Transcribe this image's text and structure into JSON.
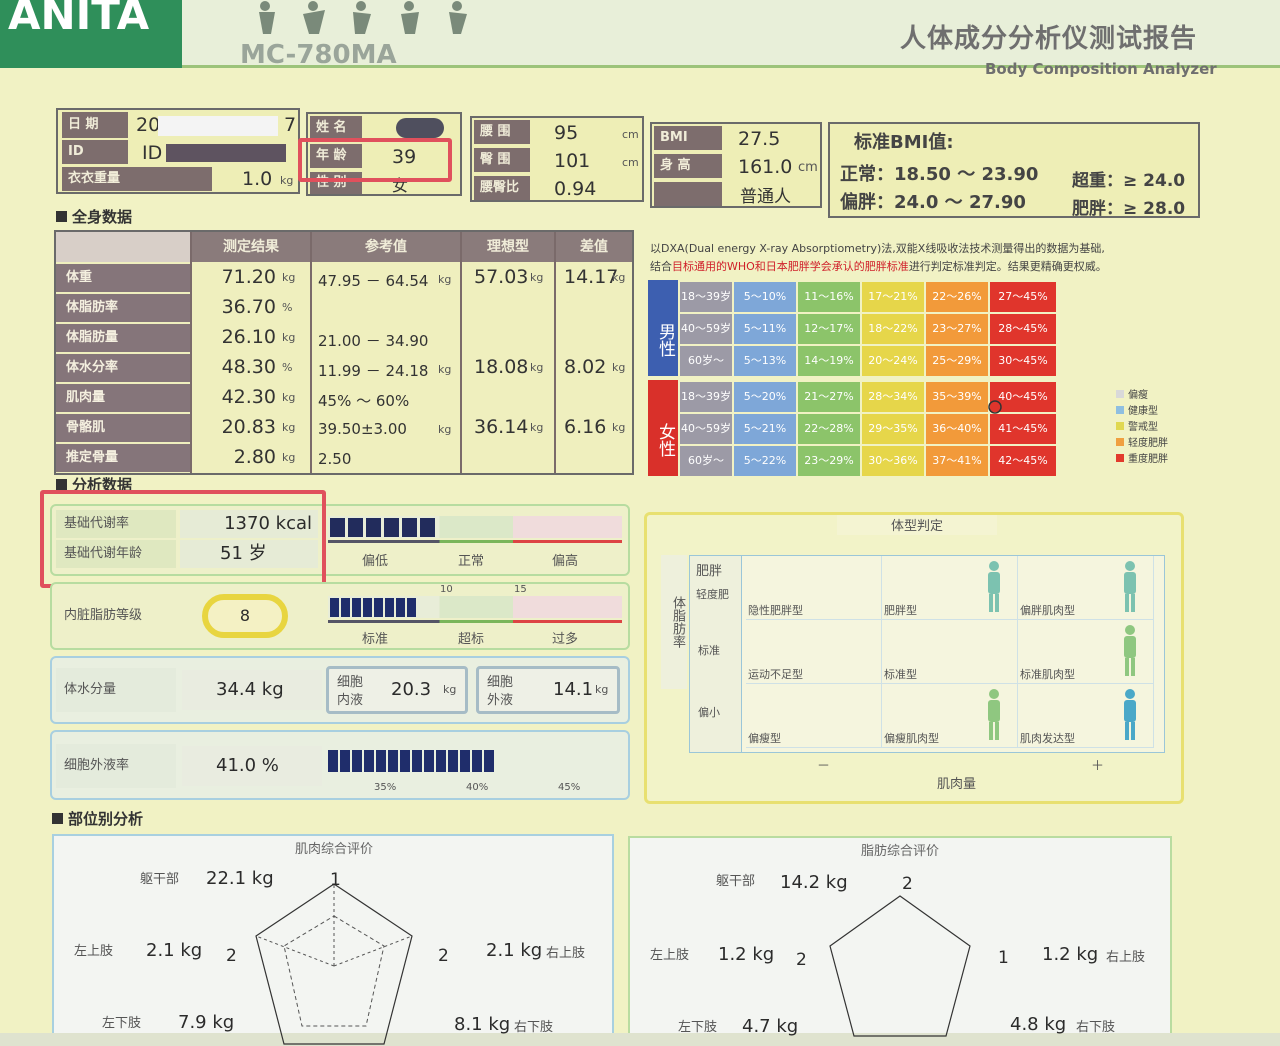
{
  "header": {
    "logo": "ANITA",
    "model": "MC-780MA",
    "title_cn": "人体成分分析仪测试报告",
    "title_en": "Body Composition Analyzer"
  },
  "info": {
    "date_label": "日 期",
    "date_value": "20",
    "date_tail": "7",
    "id_label": "ID",
    "id_value": "ID",
    "clothes_label": "衣衣重量",
    "clothes_value": "1.0",
    "clothes_unit": "kg",
    "name_label": "姓 名",
    "age_label": "年 龄",
    "age_value": "39",
    "sex_label": "性 别",
    "sex_value": "女",
    "waist_label": "腰 围",
    "waist_value": "95",
    "waist_unit": "cm",
    "hip_label": "臀 围",
    "hip_value": "101",
    "hip_unit": "cm",
    "whr_label": "腰臀比",
    "whr_value": "0.94",
    "bmi_label": "BMI",
    "bmi_value": "27.5",
    "height_label": "身 高",
    "height_value": "161.0",
    "height_unit": "cm",
    "type_value": "普通人",
    "bmi_std_title": "标准BMI值:",
    "bmi_normal": "正常：18.50 ～ 23.90",
    "bmi_over": "超重：≥ 24.0",
    "bmi_fatish": "偏胖：24.0 ～ 27.90",
    "bmi_obese": "肥胖：≥ 28.0"
  },
  "whole": {
    "section": "全身数据",
    "headers": [
      "测定结果",
      "参考值",
      "理想型",
      "差值"
    ],
    "rows": [
      {
        "label": "体重",
        "result": "71.20",
        "unit": "kg",
        "ref": "47.95 － 64.54",
        "ref_unit": "kg",
        "ideal": "57.03",
        "ideal_unit": "kg",
        "diff": "14.17",
        "diff_unit": "kg"
      },
      {
        "label": "体脂肪率",
        "result": "36.70",
        "unit": "%",
        "ref": "",
        "ref_unit": "",
        "ideal": "",
        "ideal_unit": "",
        "diff": "",
        "diff_unit": ""
      },
      {
        "label": "体脂肪量",
        "result": "26.10",
        "unit": "kg",
        "ref": "21.00 － 34.90",
        "ref_unit": "",
        "ideal": "",
        "ideal_unit": "",
        "diff": "",
        "diff_unit": ""
      },
      {
        "label": "体水分率",
        "result": "48.30",
        "unit": "%",
        "ref": "11.99 － 24.18",
        "ref_unit": "kg",
        "ideal": "18.08",
        "ideal_unit": "kg",
        "diff": "8.02",
        "diff_unit": "kg"
      },
      {
        "label": "肌肉量",
        "result": "42.30",
        "unit": "kg",
        "ref": "45% ～ 60%",
        "ref_unit": "",
        "ideal": "",
        "ideal_unit": "",
        "diff": "",
        "diff_unit": ""
      },
      {
        "label": "骨骼肌",
        "result": "20.83",
        "unit": "kg",
        "ref": "39.50±3.00",
        "ref_unit": "kg",
        "ideal": "36.14",
        "ideal_unit": "kg",
        "diff": "6.16",
        "diff_unit": "kg"
      },
      {
        "label": "推定骨量",
        "result": "2.80",
        "unit": "kg",
        "ref": "2.50",
        "ref_unit": "",
        "ideal": "",
        "ideal_unit": "",
        "diff": "",
        "diff_unit": ""
      }
    ]
  },
  "fatchart": {
    "note1": "以DXA(Dual energy X-ray Absorptiometry)法,双能X线吸收法技术测量得出的数据为基础,",
    "note2_a": "结合",
    "note2_red": "目标通用的WHO和日本肥胖学会承认的肥胖标准",
    "note2_b": "进行判定标准判定。结果更精确更权威。",
    "male": "男性",
    "female": "女性",
    "male_rows": [
      [
        "18～39岁",
        "5～10%",
        "11～16%",
        "17～21%",
        "22～26%",
        "27～45%"
      ],
      [
        "40～59岁",
        "5～11%",
        "12～17%",
        "18～22%",
        "23～27%",
        "28～45%"
      ],
      [
        "60岁～",
        "5～13%",
        "14～19%",
        "20～24%",
        "25～29%",
        "30～45%"
      ]
    ],
    "female_rows": [
      [
        "18～39岁",
        "5～20%",
        "21～27%",
        "28～34%",
        "35～39%",
        "40～45%"
      ],
      [
        "40～59岁",
        "5～21%",
        "22～28%",
        "29～35%",
        "36～40%",
        "41～45%"
      ],
      [
        "60岁～",
        "5～22%",
        "23～29%",
        "30～36%",
        "37～41%",
        "42～45%"
      ]
    ],
    "legend": [
      "偏瘦",
      "健康型",
      "警戒型",
      "轻度肥胖",
      "重度肥胖"
    ],
    "colors": [
      "#d9d9d9",
      "#8fbfe0",
      "#e0d850",
      "#f0a040",
      "#e23b2c"
    ]
  },
  "analysis": {
    "section": "分析数据",
    "bmr_label": "基础代谢率",
    "bmr_value": "1370 kcal",
    "bmr_age_label": "基础代谢年龄",
    "bmr_age_value": "51 岁",
    "bmr_scale": [
      "偏低",
      "正常",
      "偏高"
    ],
    "bmr_fill": 0.33,
    "visceral_label": "内脏脂肪等级",
    "visceral_value": "8",
    "visceral_ticks": [
      "10",
      "15"
    ],
    "visceral_scale": [
      "标准",
      "超标",
      "过多"
    ],
    "water_label": "体水分量",
    "water_value": "34.4 kg",
    "icw_label1": "细胞",
    "icw_label2": "内液",
    "icw_value": "20.3",
    "icw_unit": "kg",
    "ecw_label1": "细胞",
    "ecw_label2": "外液",
    "ecw_value": "14.1",
    "ecw_unit": "kg",
    "ecw_rate_label": "细胞外液率",
    "ecw_rate_value": "41.0 %",
    "ecw_scale": [
      "35%",
      "40%",
      "45%"
    ]
  },
  "bodytype": {
    "title": "体型判定",
    "ylabel": "体脂肪率",
    "xlabel": "肌肉量",
    "rows": [
      "肥胖",
      "标准",
      "偏小"
    ],
    "extra_row": "轻度肥",
    "cells": [
      [
        "隐性肥胖型",
        "肥胖型",
        "偏胖肌肉型"
      ],
      [
        "运动不足型",
        "标准型",
        "标准肌肉型"
      ],
      [
        "偏瘦型",
        "偏瘦肌肉型",
        "肌肉发达型"
      ]
    ],
    "minus": "－",
    "plus": "＋"
  },
  "segment": {
    "section": "部位别分析",
    "muscle_title": "肌肉综合评价",
    "fat_title": "脂肪综合评价",
    "trunk_label": "躯干部",
    "left_arm_label": "左上肢",
    "right_arm_label": "右上肢",
    "left_leg_label": "左下肢",
    "right_leg_label": "右下肢",
    "muscle": {
      "trunk": "22.1 kg",
      "left_arm": "2.1 kg",
      "right_arm": "2.1 kg",
      "left_leg": "7.9 kg",
      "right_leg": "8.1 kg",
      "trunk_score": "1",
      "left_score": "2",
      "right_score": "2"
    },
    "fat": {
      "trunk": "14.2 kg",
      "left_arm": "1.2 kg",
      "right_arm": "1.2 kg",
      "left_leg": "4.7 kg",
      "right_leg": "4.8 kg",
      "trunk_score": "2",
      "left_score": "2",
      "right_score": "1"
    }
  }
}
